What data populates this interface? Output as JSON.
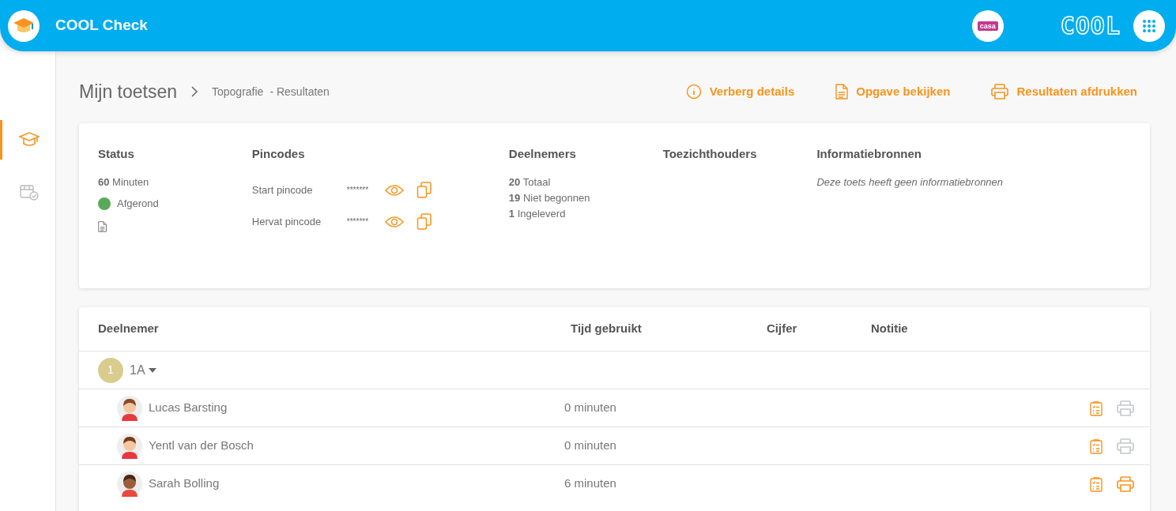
{
  "app": {
    "title": "COOL Check",
    "school_logo": "casa",
    "brand": "COOL"
  },
  "sidebar": {
    "items": [
      {
        "kind": "tests",
        "selected": true
      },
      {
        "kind": "calendar",
        "selected": false
      }
    ]
  },
  "breadcrumb": {
    "root": "Mijn toetsen",
    "test": "Topografie",
    "page": "- Resultaten"
  },
  "actions": [
    {
      "kind": "info",
      "label": "Verberg details"
    },
    {
      "kind": "document",
      "label": "Opgave bekijken"
    },
    {
      "kind": "print",
      "label": "Resultaten afdrukken"
    }
  ],
  "details": {
    "status": {
      "title": "Status",
      "duration_value": "60",
      "duration_unit": "Minuten",
      "state": "Afgerond",
      "color": "#5aa95a"
    },
    "pincodes": {
      "title": "Pincodes",
      "items": [
        {
          "label": "Start pincode",
          "value": "*******"
        },
        {
          "label": "Hervat pincode",
          "value": "*******"
        }
      ]
    },
    "participants": {
      "title": "Deelnemers",
      "items": [
        {
          "count": "20",
          "label": "Totaal"
        },
        {
          "count": "19",
          "label": "Niet begonnen"
        },
        {
          "count": "1",
          "label": "Ingeleverd"
        }
      ]
    },
    "supervisors": {
      "title": "Toezichthouders"
    },
    "sources": {
      "title": "Informatiebronnen",
      "note": "Deze toets heeft geen informatiebronnen"
    }
  },
  "table": {
    "columns": [
      "Deelnemer",
      "Tijd gebruikt",
      "Cijfer",
      "Notitie"
    ],
    "group": {
      "badge": "1",
      "name": "1A",
      "expanded": true
    },
    "rows": [
      {
        "name": "Lucas Barsting",
        "time": "0 minuten",
        "kind": "boy",
        "print_disabled": true
      },
      {
        "name": "Yentl van der Bosch",
        "time": "0 minuten",
        "kind": "girl",
        "print_disabled": true
      },
      {
        "name": "Sarah Bolling",
        "time": "6 minuten",
        "kind": "girl-dark",
        "print_disabled": false
      }
    ]
  }
}
